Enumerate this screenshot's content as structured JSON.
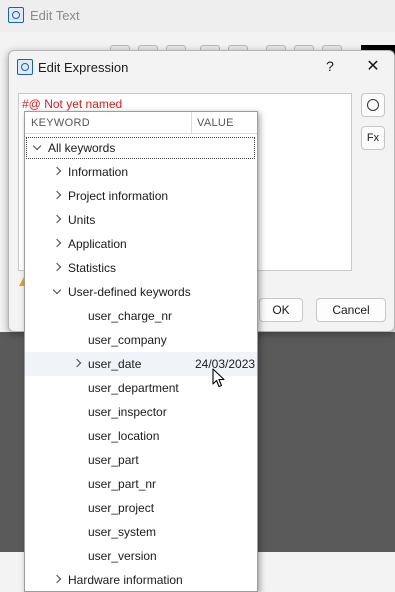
{
  "background_window": {
    "title": "Edit Text",
    "title_icon": "search-icon"
  },
  "dialog": {
    "title": "Edit Expression",
    "title_icon": "search-icon",
    "help_label": "?",
    "close_label": "✕",
    "editor_text": "#@ Not yet named",
    "side_button_1_icon": "circle-icon",
    "side_button_2_label": "Fx",
    "ok_label": "OK",
    "cancel_label": "Cancel"
  },
  "keyword_popup": {
    "columns": {
      "keyword": "KEYWORD",
      "value": "VALUE"
    },
    "rows": [
      {
        "label": "All keywords",
        "level": 0,
        "arrow": "down",
        "value": ""
      },
      {
        "label": "Information",
        "level": 1,
        "arrow": "right",
        "value": ""
      },
      {
        "label": "Project information",
        "level": 1,
        "arrow": "right",
        "value": ""
      },
      {
        "label": "Units",
        "level": 1,
        "arrow": "right",
        "value": ""
      },
      {
        "label": "Application",
        "level": 1,
        "arrow": "right",
        "value": ""
      },
      {
        "label": "Statistics",
        "level": 1,
        "arrow": "right",
        "value": ""
      },
      {
        "label": "User-defined keywords",
        "level": 1,
        "arrow": "down",
        "value": ""
      },
      {
        "label": "user_charge_nr",
        "level": 2,
        "arrow": "",
        "value": ""
      },
      {
        "label": "user_company",
        "level": 2,
        "arrow": "",
        "value": ""
      },
      {
        "label": "user_date",
        "level": 2,
        "arrow": "right",
        "value": "24/03/2023"
      },
      {
        "label": "user_department",
        "level": 2,
        "arrow": "",
        "value": ""
      },
      {
        "label": "user_inspector",
        "level": 2,
        "arrow": "",
        "value": ""
      },
      {
        "label": "user_location",
        "level": 2,
        "arrow": "",
        "value": ""
      },
      {
        "label": "user_part",
        "level": 2,
        "arrow": "",
        "value": ""
      },
      {
        "label": "user_part_nr",
        "level": 2,
        "arrow": "",
        "value": ""
      },
      {
        "label": "user_project",
        "level": 2,
        "arrow": "",
        "value": ""
      },
      {
        "label": "user_system",
        "level": 2,
        "arrow": "",
        "value": ""
      },
      {
        "label": "user_version",
        "level": 2,
        "arrow": "",
        "value": ""
      },
      {
        "label": "Hardware information",
        "level": 1,
        "arrow": "right",
        "value": ""
      }
    ]
  },
  "colors": {
    "accent": "#1f5fb0",
    "editor_text": "#d81e1e",
    "hover_row": "#f0f4f8",
    "warning": "#e7a21a"
  }
}
